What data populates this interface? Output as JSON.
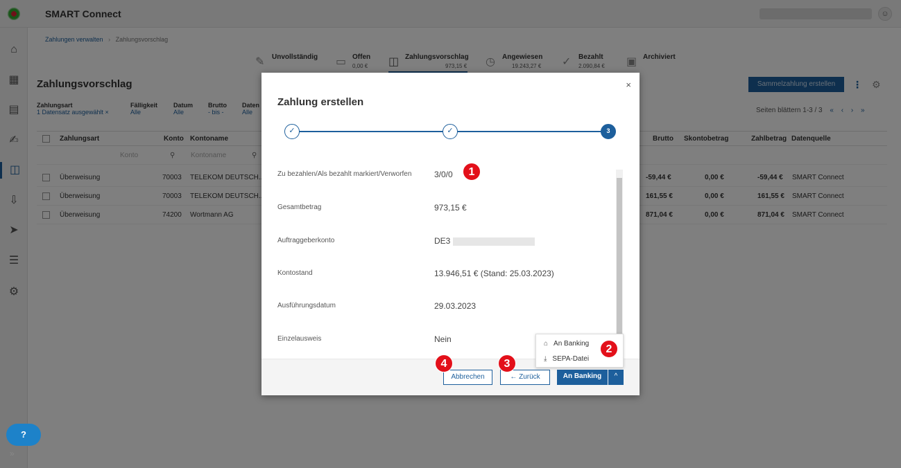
{
  "app": {
    "name": "SMART Connect"
  },
  "breadcrumb": {
    "parent": "Zahlungen verwalten",
    "sep": "›",
    "current": "Zahlungsvorschlag"
  },
  "tabs": [
    {
      "label": "Unvollständig",
      "value": "",
      "icon": "edit-icon"
    },
    {
      "label": "Offen",
      "value": "0,00 €",
      "icon": "inbox-icon"
    },
    {
      "label": "Zahlungsvorschlag",
      "value": "973,15 €",
      "icon": "payment-proposal-icon"
    },
    {
      "label": "Angewiesen",
      "value": "19.243,27 €",
      "icon": "clock-icon"
    },
    {
      "label": "Bezahlt",
      "value": "2.090,84 €",
      "icon": "check-icon"
    },
    {
      "label": "Archiviert",
      "value": "",
      "icon": "archive-icon"
    }
  ],
  "page": {
    "title": "Zahlungsvorschlag",
    "sammel_button": "Sammelzahlung erstellen"
  },
  "filters": [
    {
      "label": "Zahlungsart",
      "value": "1 Datensatz ausgewählt ×"
    },
    {
      "label": "Fälligkeit",
      "value": "Alle"
    },
    {
      "label": "Datum",
      "value": "Alle"
    },
    {
      "label": "Brutto",
      "value": "- bis -"
    },
    {
      "label": "Daten",
      "value": "Alle"
    }
  ],
  "paging": {
    "label": "Seiten blättern 1-3 / 3",
    "first": "«",
    "prev": "‹",
    "next": "›",
    "last": "»"
  },
  "table": {
    "headers": {
      "zahlungsart": "Zahlungsart",
      "konto": "Konto",
      "kontoname": "Kontoname",
      "brutto": "Brutto",
      "skonto": "Skontobetrag",
      "zahlbetrag": "Zahlbetrag",
      "datenquelle": "Datenquelle"
    },
    "filter_placeholders": {
      "konto": "Konto",
      "kontoname": "Kontoname"
    },
    "rows": [
      {
        "zahlungsart": "Überweisung",
        "konto": "70003",
        "kontoname": "TELEKOM DEUTSCH...",
        "brutto": "-59,44 €",
        "skonto": "0,00 €",
        "zahlbetrag": "-59,44 €",
        "datenquelle": "SMART Connect"
      },
      {
        "zahlungsart": "Überweisung",
        "konto": "70003",
        "kontoname": "TELEKOM DEUTSCH...",
        "brutto": "161,55 €",
        "skonto": "0,00 €",
        "zahlbetrag": "161,55 €",
        "datenquelle": "SMART Connect"
      },
      {
        "zahlungsart": "Überweisung",
        "konto": "74200",
        "kontoname": "Wortmann AG",
        "brutto": "871,04 €",
        "skonto": "0,00 €",
        "zahlbetrag": "871,04 €",
        "datenquelle": "SMART Connect"
      }
    ]
  },
  "modal": {
    "title": "Zahlung erstellen",
    "close": "×",
    "steps": [
      "✓",
      "✓",
      "3"
    ],
    "rows": [
      {
        "label": "Zu bezahlen/Als bezahlt markiert/Verworfen",
        "value": "3/0/0"
      },
      {
        "label": "Gesamtbetrag",
        "value": "973,15 €"
      },
      {
        "label": "Auftraggeberkonto",
        "value": "DE3"
      },
      {
        "label": "Kontostand",
        "value": "13.946,51 € (Stand: 25.03.2023)"
      },
      {
        "label": "Ausführungsdatum",
        "value": "29.03.2023"
      },
      {
        "label": "Einzelausweis",
        "value": "Nein"
      }
    ],
    "buttons": {
      "cancel": "Abbrechen",
      "back": "← Zurück",
      "primary": "An Banking",
      "toggle": "^"
    },
    "dropdown": [
      {
        "label": "An Banking",
        "icon": "bank-icon"
      },
      {
        "label": "SEPA-Datei",
        "icon": "download-icon"
      }
    ]
  },
  "callouts": [
    "1",
    "2",
    "3",
    "4"
  ],
  "help": "?",
  "colors": {
    "primary": "#1d5f9c",
    "callout": "#e3101a"
  }
}
